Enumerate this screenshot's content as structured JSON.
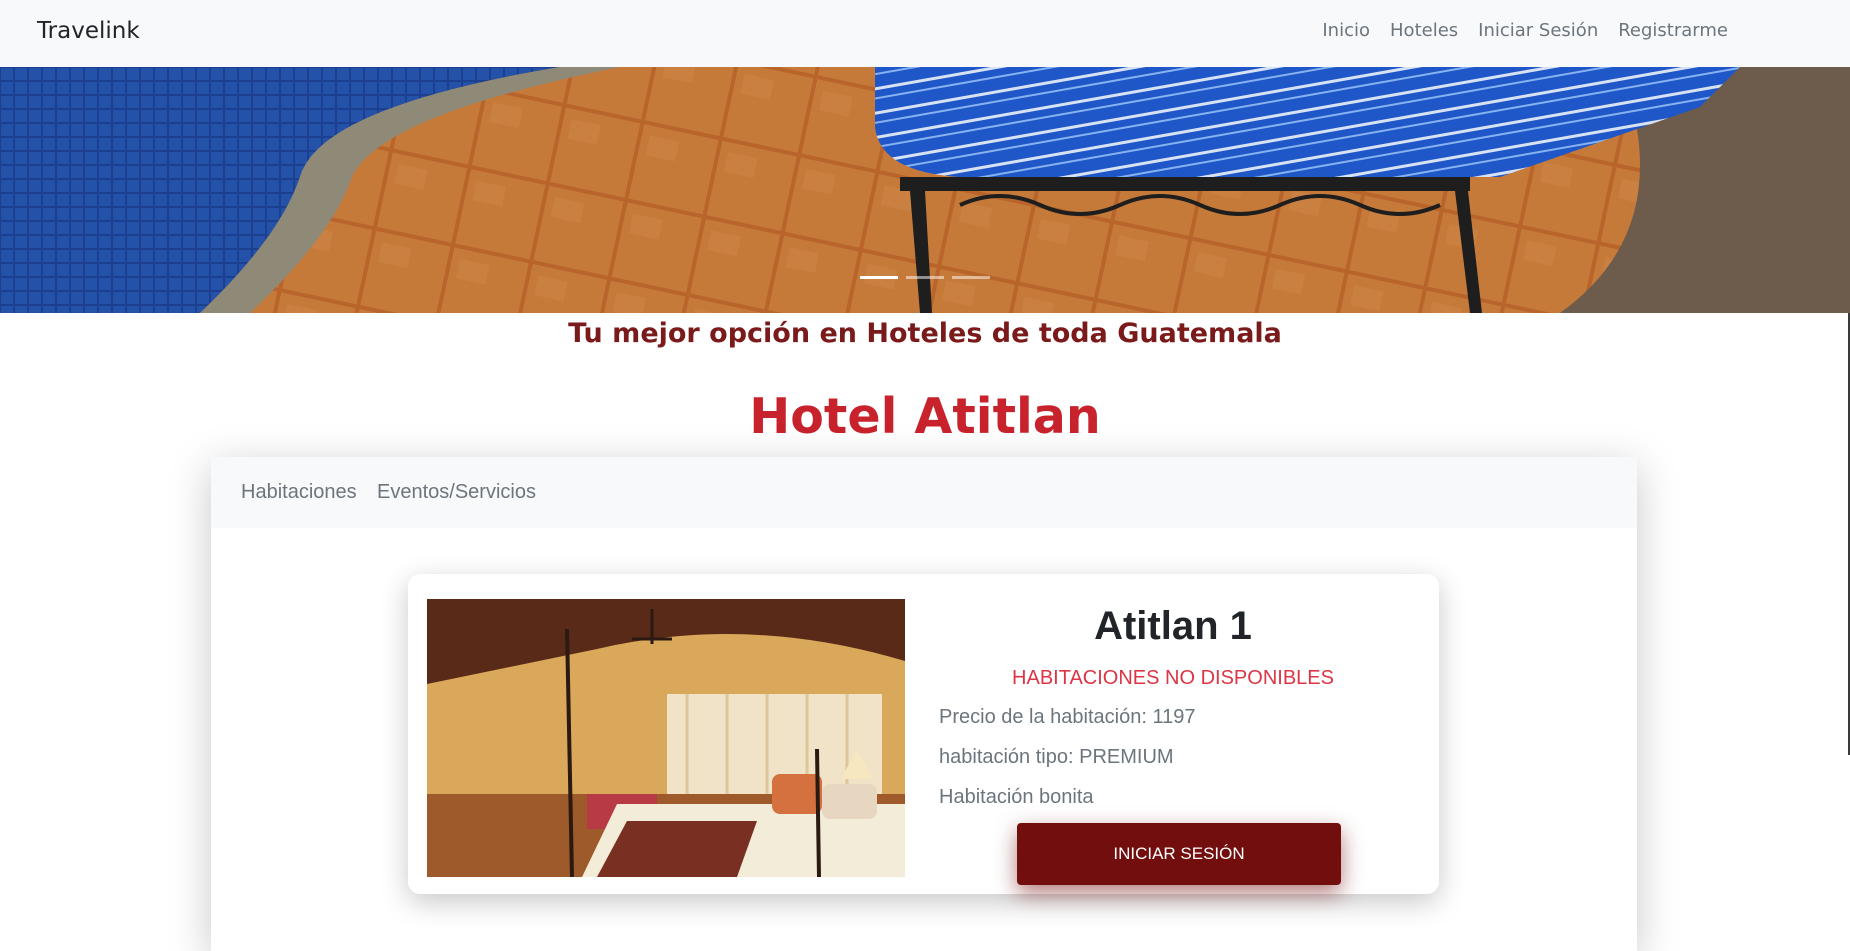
{
  "navbar": {
    "brand": "Travelink",
    "links": [
      "Inicio",
      "Hoteles",
      "Iniciar Sesión",
      "Registrarme"
    ]
  },
  "hero": {
    "slides_count": 3,
    "active_slide": 1
  },
  "tagline": "Tu mejor opción en Hoteles de toda Guatemala",
  "hotel": {
    "name": "Hotel Atitlan"
  },
  "tabs": [
    "Habitaciones",
    "Eventos/Servicios"
  ],
  "room": {
    "name": "Atitlan 1",
    "status": "HABITACIONES NO DISPONIBLES",
    "price": "Precio de la habitación: 1197",
    "type": "habitación tipo: PREMIUM",
    "description": "Habitación bonita",
    "button": "INICIAR SESIÓN"
  },
  "colors": {
    "navbar_bg": "#f8f9fa",
    "title_red": "#c8232c",
    "tagline_maroon": "#7a1a1a",
    "button_maroon": "#720e0e",
    "status_red": "#dc3545"
  }
}
